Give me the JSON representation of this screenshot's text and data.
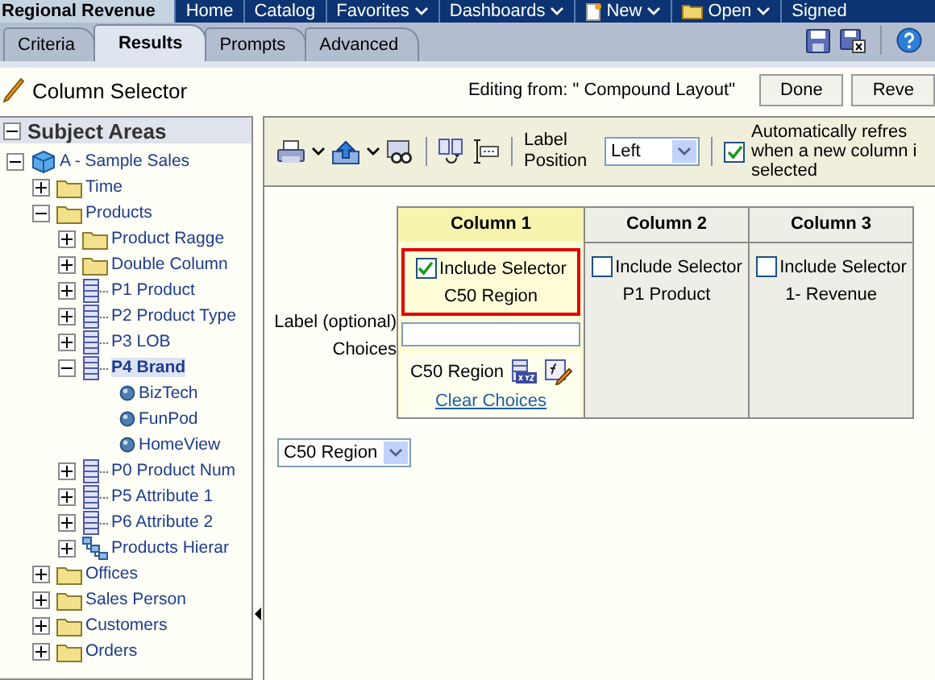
{
  "app_title": "Regional Revenue",
  "nav": [
    {
      "label": "Home",
      "menu": false,
      "kind": "plain"
    },
    {
      "label": "Catalog",
      "menu": false,
      "kind": "plain"
    },
    {
      "label": "Favorites",
      "menu": true,
      "kind": "plain"
    },
    {
      "label": "Dashboards",
      "menu": true,
      "kind": "plain"
    },
    {
      "label": "New",
      "menu": true,
      "kind": "document"
    },
    {
      "label": "Open",
      "menu": true,
      "kind": "folder"
    },
    {
      "label": "Signed",
      "menu": false,
      "kind": "plain"
    }
  ],
  "tabs": [
    {
      "label": "Criteria",
      "selected": false
    },
    {
      "label": "Results",
      "selected": true
    },
    {
      "label": "Prompts",
      "selected": false
    },
    {
      "label": "Advanced",
      "selected": false
    }
  ],
  "header": {
    "title": "Column Selector",
    "editing": "Editing from: \" Compound Layout\"",
    "buttons": [
      "Done",
      "Reve"
    ]
  },
  "subject_areas": {
    "title": "Subject Areas",
    "tree": [
      {
        "label": "A - Sample Sales",
        "kind": "subject",
        "expanded": true,
        "selected": false,
        "children": [
          {
            "label": "Time",
            "kind": "folder",
            "expanded": false,
            "selected": false
          },
          {
            "label": "Products",
            "kind": "folder",
            "expanded": true,
            "selected": false,
            "children": [
              {
                "label": "Product Ragge",
                "kind": "folder",
                "expanded": false,
                "selected": false
              },
              {
                "label": "Double Column",
                "kind": "folder",
                "expanded": false,
                "selected": false
              },
              {
                "label": "P1 Product",
                "kind": "level",
                "expanded": false,
                "selected": false
              },
              {
                "label": "P2 Product Type",
                "kind": "level",
                "expanded": false,
                "selected": false
              },
              {
                "label": "P3 LOB",
                "kind": "level",
                "expanded": false,
                "selected": false
              },
              {
                "label": "P4 Brand",
                "kind": "level",
                "expanded": true,
                "selected": true,
                "children": [
                  {
                    "label": "BizTech",
                    "kind": "member",
                    "selected": false
                  },
                  {
                    "label": "FunPod",
                    "kind": "member",
                    "selected": false
                  },
                  {
                    "label": "HomeView",
                    "kind": "member",
                    "selected": false
                  }
                ]
              },
              {
                "label": "P0 Product Num",
                "kind": "level",
                "expanded": false,
                "selected": false
              },
              {
                "label": "P5 Attribute 1",
                "kind": "level",
                "expanded": false,
                "selected": false
              },
              {
                "label": "P6 Attribute 2",
                "kind": "level",
                "expanded": false,
                "selected": false
              },
              {
                "label": "Products Hierar",
                "kind": "hierarchy",
                "expanded": false,
                "selected": false
              }
            ]
          },
          {
            "label": "Offices",
            "kind": "folder",
            "expanded": false,
            "selected": false
          },
          {
            "label": "Sales Person",
            "kind": "folder",
            "expanded": false,
            "selected": false
          },
          {
            "label": "Customers",
            "kind": "folder",
            "expanded": false,
            "selected": false
          },
          {
            "label": "Orders",
            "kind": "folder",
            "expanded": false,
            "selected": false
          }
        ]
      }
    ]
  },
  "toolbar": {
    "label_position_label": "Label Position",
    "label_position": "Left",
    "auto_refresh": {
      "checked": true,
      "lines": [
        "Automatically refres",
        "when a new column i",
        "selected"
      ]
    }
  },
  "row_labels": [
    "Label (optional)",
    "Choices"
  ],
  "columns": [
    {
      "header": "Column 1",
      "selected": true,
      "include_label": "Include Selector",
      "include_selector": true,
      "name": "C50 Region",
      "choice": "C50 Region",
      "clear_link": "Clear Choices"
    },
    {
      "header": "Column 2",
      "selected": false,
      "include_label": "Include Selector",
      "include_selector": false,
      "name": "P1 Product"
    },
    {
      "header": "Column 3",
      "selected": false,
      "include_label": "Include Selector",
      "include_selector": false,
      "name": "1- Revenue"
    }
  ],
  "preview_dropdown": "C50 Region"
}
